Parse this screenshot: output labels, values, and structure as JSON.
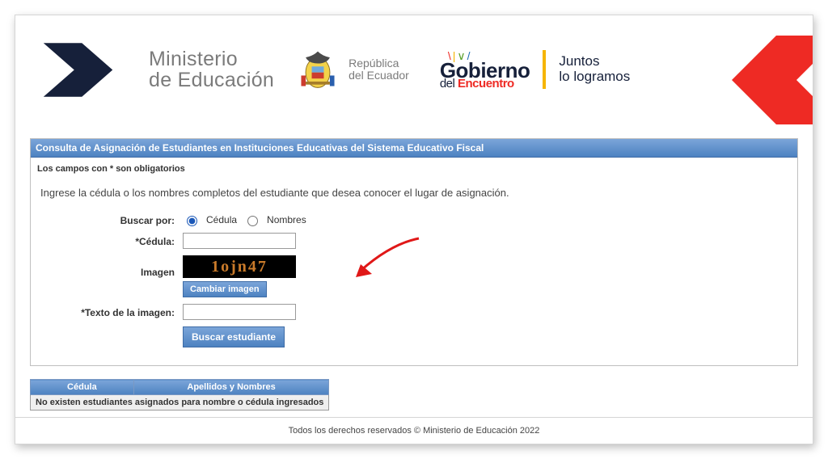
{
  "header": {
    "ministry_line1": "Ministerio",
    "ministry_line2": "de Educación",
    "republic_line1": "República",
    "republic_line2": "del Ecuador",
    "gobierno_label": "Gobierno",
    "encuentro_prefix": "del ",
    "encuentro_word": "Encuentro",
    "juntos_line1": "Juntos",
    "juntos_line2": "lo logramos"
  },
  "panel": {
    "title": "Consulta de Asignación de Estudiantes en Instituciones Educativas del Sistema Educativo Fiscal",
    "required_note": "Los campos con * son obligatorios",
    "instruction": "Ingrese la cédula o los nombres completos del estudiante que desea conocer el lugar de asignación."
  },
  "form": {
    "buscar_por_label": "Buscar por:",
    "radio_cedula": "Cédula",
    "radio_nombres": "Nombres",
    "radio_selected": "cedula",
    "cedula_label": "*Cédula:",
    "cedula_value": "",
    "imagen_label": "Imagen",
    "captcha_text": "1ojn47",
    "cambiar_imagen_label": "Cambiar imagen",
    "texto_imagen_label": "*Texto de la imagen:",
    "texto_imagen_value": "",
    "buscar_btn_label": "Buscar estudiante"
  },
  "results": {
    "col_cedula": "Cédula",
    "col_nombres": "Apellidos y Nombres",
    "empty_message": "No existen estudiantes asignados para nombre o cédula ingresados"
  },
  "footer": {
    "text": "Todos los derechos reservados © Ministerio de Educación 2022"
  }
}
